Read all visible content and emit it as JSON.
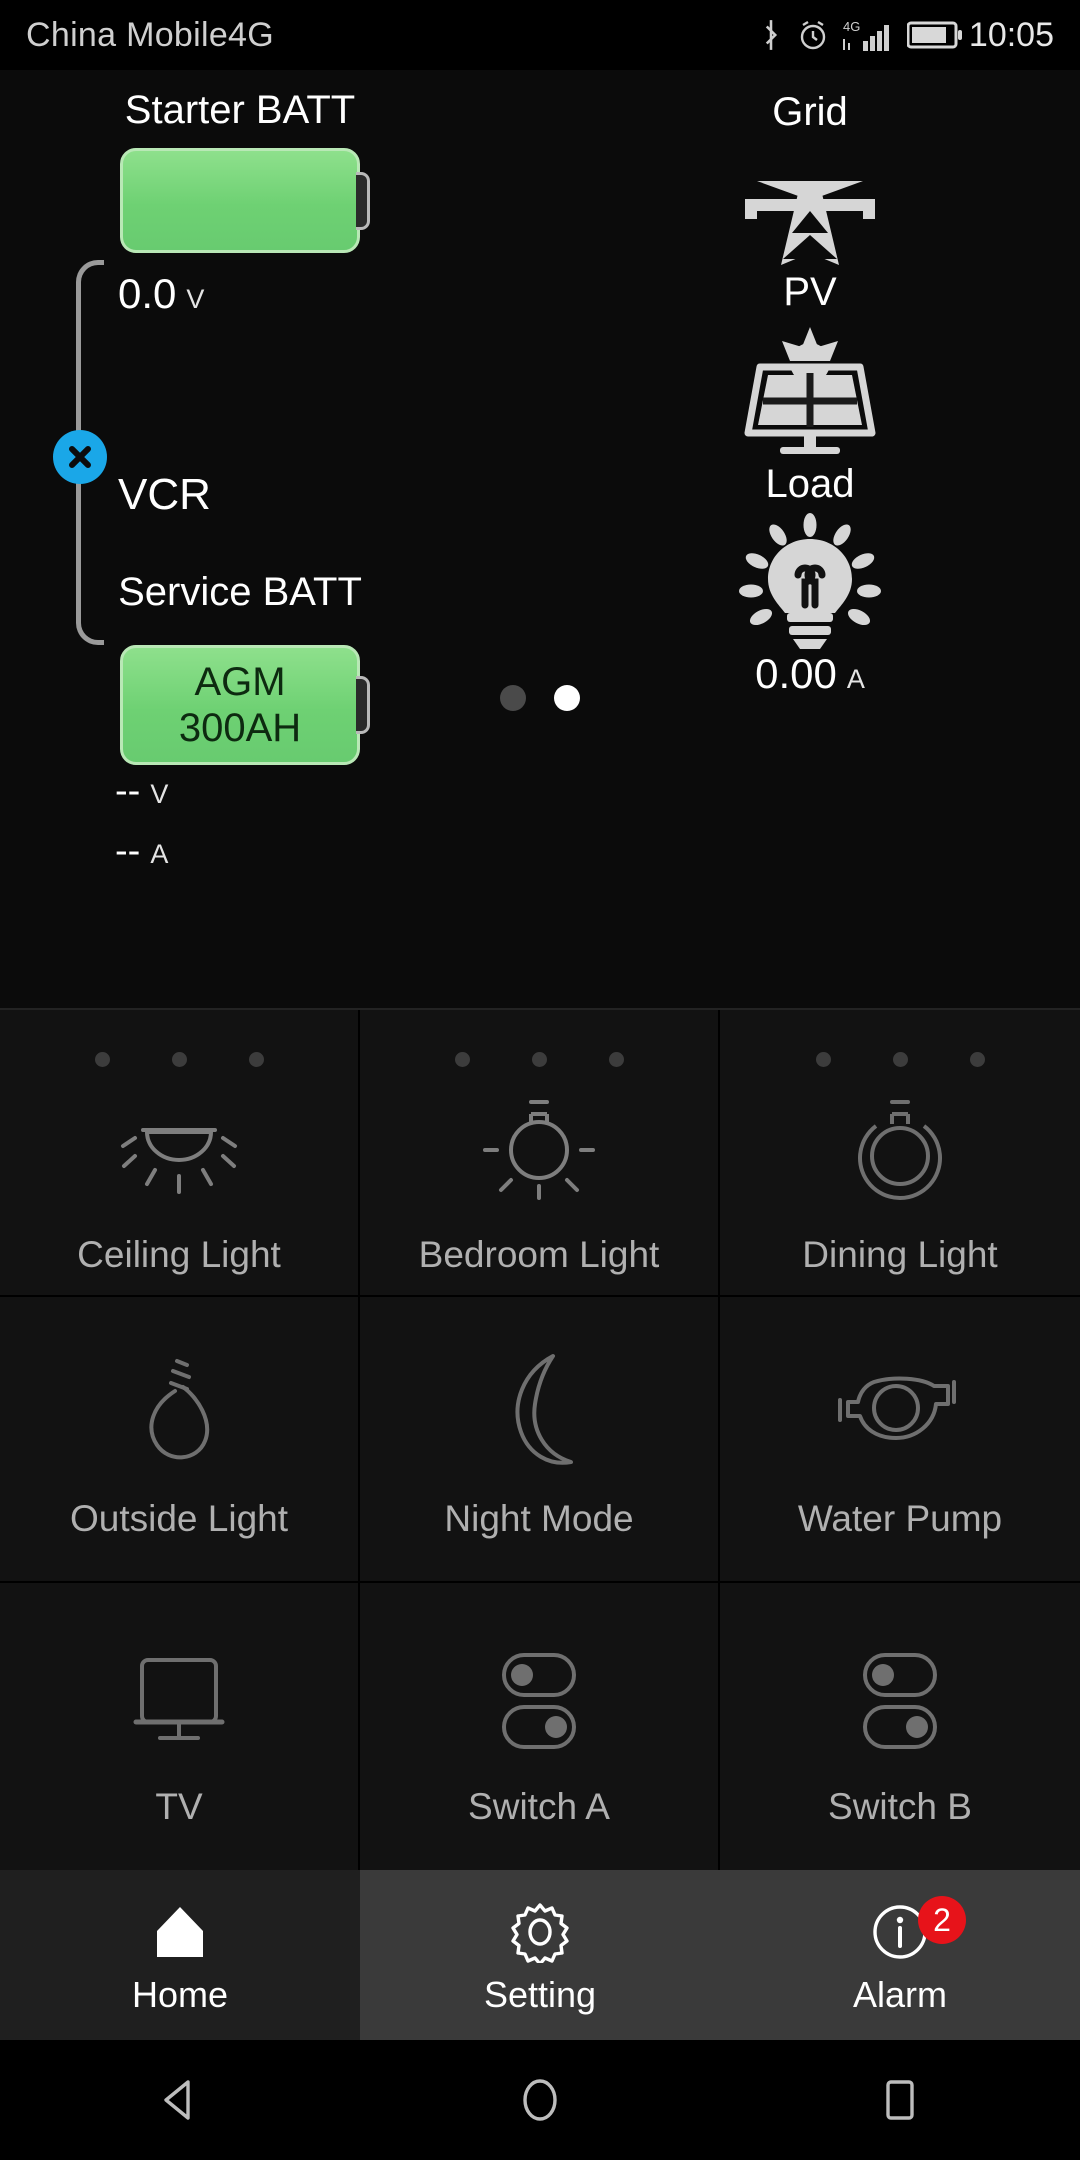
{
  "statusbar": {
    "carrier": "China Mobile4G",
    "clock": "10:05",
    "icons": [
      "bluetooth-icon",
      "alarm-clock-icon",
      "signal-4g-icon",
      "battery-icon"
    ]
  },
  "dashboard": {
    "starter_battery": {
      "label": "Starter BATT",
      "voltage": "0.0",
      "voltage_unit": "V",
      "fill_percent": 100,
      "fill_color": "#6ed173"
    },
    "vcr": {
      "label": "VCR",
      "state_icon": "cross-circle-icon",
      "state_color": "#1aa7e8"
    },
    "service_battery": {
      "label": "Service BATT",
      "type": "AGM",
      "capacity": "300AH",
      "voltage": "--",
      "voltage_unit": "V",
      "current": "--",
      "current_unit": "A",
      "fill_color": "#6ed173"
    },
    "grid": {
      "label": "Grid",
      "icon": "power-pylon-icon"
    },
    "pv": {
      "label": "PV",
      "icon": "solar-panel-icon"
    },
    "load": {
      "label": "Load",
      "icon": "light-bulb-icon",
      "current": "0.00",
      "current_unit": "A"
    },
    "pager": {
      "count": 2,
      "active_index": 1
    }
  },
  "controls": [
    {
      "label": "Ceiling Light",
      "icon": "ceiling-dome-light-icon",
      "header_dots": 3
    },
    {
      "label": "Bedroom Light",
      "icon": "bulb-rays-icon",
      "header_dots": 3
    },
    {
      "label": "Dining Light",
      "icon": "pendant-bulb-icon",
      "header_dots": 3
    },
    {
      "label": "Outside Light",
      "icon": "outdoor-bulb-icon",
      "header_dots": 0
    },
    {
      "label": "Night Mode",
      "icon": "crescent-moon-icon",
      "header_dots": 0
    },
    {
      "label": "Water Pump",
      "icon": "water-pump-icon",
      "header_dots": 0
    },
    {
      "label": "TV",
      "icon": "television-icon",
      "header_dots": 0
    },
    {
      "label": "Switch A",
      "icon": "dual-toggle-icon",
      "header_dots": 0
    },
    {
      "label": "Switch B",
      "icon": "dual-toggle-icon",
      "header_dots": 0
    }
  ],
  "bottom_nav": [
    {
      "label": "Home",
      "icon": "home-icon",
      "active": true,
      "badge": null
    },
    {
      "label": "Setting",
      "icon": "gear-icon",
      "active": false,
      "badge": null
    },
    {
      "label": "Alarm",
      "icon": "info-circle-icon",
      "active": false,
      "badge": "2"
    }
  ],
  "android_nav": [
    {
      "name": "back-button",
      "icon": "triangle-back-icon"
    },
    {
      "name": "home-button",
      "icon": "circle-home-icon"
    },
    {
      "name": "recents-button",
      "icon": "square-recents-icon"
    }
  ],
  "colors": {
    "accent_green": "#6ed173",
    "accent_blue": "#1aa7e8",
    "badge_red": "#e7131a",
    "background": "#0b0b0b"
  }
}
